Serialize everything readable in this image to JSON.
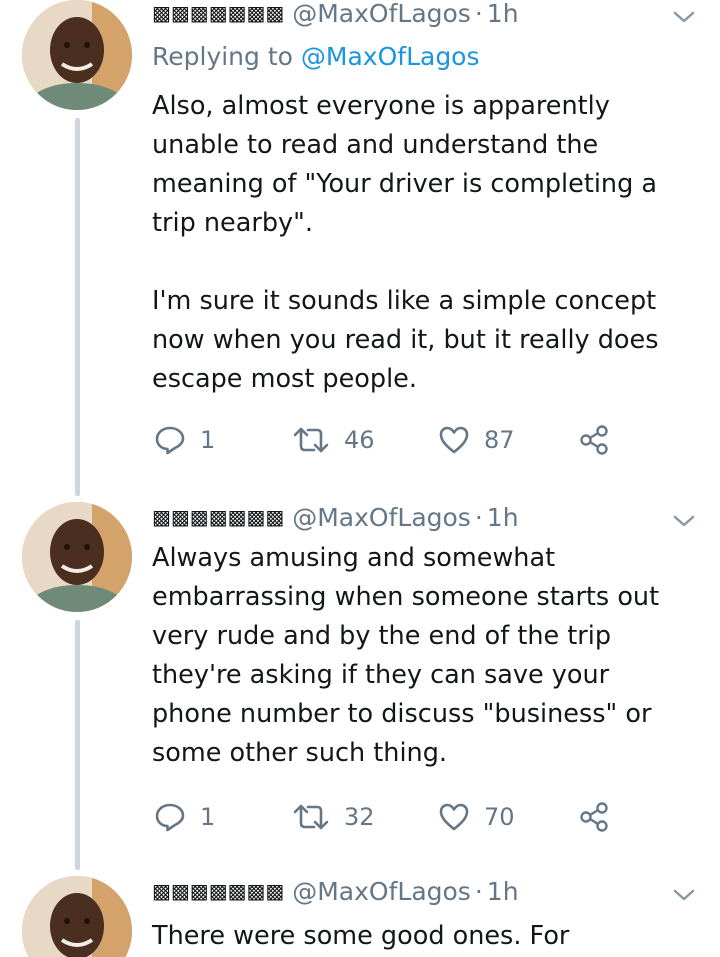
{
  "tweets": [
    {
      "display_name": "▩▩▩▩▩▩▩",
      "handle": "@MaxOfLagos",
      "separator": "·",
      "time": "1h",
      "replying_prefix": "Replying to",
      "replying_to": "@MaxOfLagos",
      "text": "Also, almost everyone is apparently unable to read and understand the meaning of \"Your driver is completing a trip nearby\".\n\nI'm sure it sounds like a simple concept now when you read it, but it really does escape most people.",
      "replies": "1",
      "retweets": "46",
      "likes": "87"
    },
    {
      "display_name": "▩▩▩▩▩▩▩",
      "handle": "@MaxOfLagos",
      "separator": "·",
      "time": "1h",
      "text": "Always amusing and somewhat embarrassing when someone starts out very rude and by the end of the trip they're asking if they can save your phone number to discuss \"business\" or some other such thing.",
      "replies": "1",
      "retweets": "32",
      "likes": "70"
    },
    {
      "display_name": "▩▩▩▩▩▩▩",
      "handle": "@MaxOfLagos",
      "separator": "·",
      "time": "1h",
      "text": "There were some good ones. For"
    }
  ],
  "icons": {
    "reply": "reply-icon",
    "retweet": "retweet-icon",
    "like": "heart-icon",
    "share": "share-icon",
    "menu": "chevron-down-icon"
  },
  "colors": {
    "text": "#14171a",
    "secondary": "#657786",
    "link": "#1b95e0",
    "thread_line": "#cdd6dd"
  }
}
